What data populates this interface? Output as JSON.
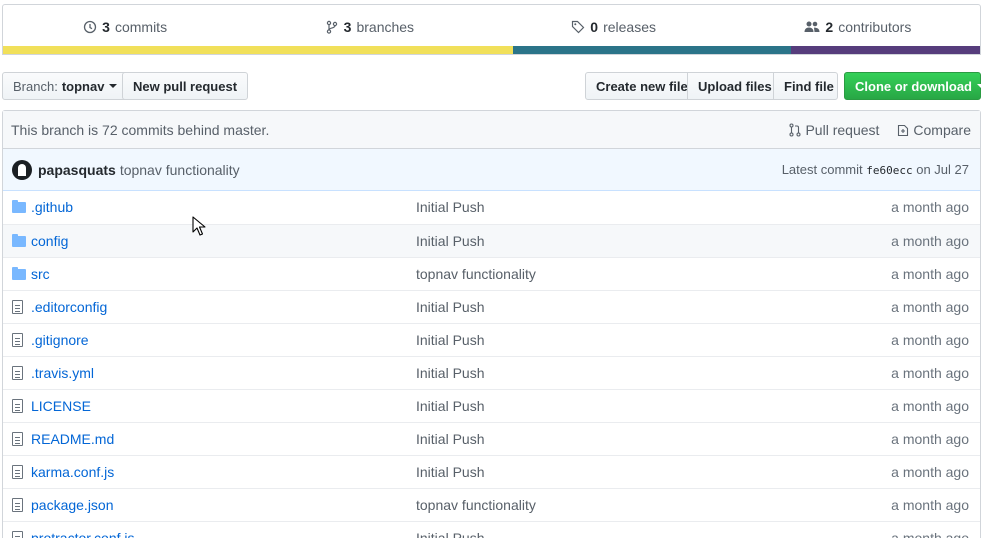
{
  "summary": {
    "commits": {
      "num": "3",
      "label": "commits",
      "icon": "history-icon"
    },
    "branches": {
      "num": "3",
      "label": "branches",
      "icon": "branch-icon"
    },
    "releases": {
      "num": "0",
      "label": "releases",
      "icon": "tag-icon"
    },
    "contributors": {
      "num": "2",
      "label": "contributors",
      "icon": "people-icon"
    }
  },
  "language_bar": [
    {
      "name": "language-1",
      "color": "#f1e05a",
      "fraction": 0.522
    },
    {
      "name": "language-2",
      "color": "#2b7489",
      "fraction": 0.285
    },
    {
      "name": "language-3",
      "color": "#563d7c",
      "fraction": 0.193
    }
  ],
  "toolbar": {
    "branch_prefix": "Branch:",
    "branch_name": "topnav",
    "new_pull_request": "New pull request",
    "create_new_file": "Create new file",
    "upload_files": "Upload files",
    "find_file": "Find file",
    "clone_or_download": "Clone or download"
  },
  "branch_info": {
    "text": "This branch is 72 commits behind master.",
    "pull_request": "Pull request",
    "compare": "Compare"
  },
  "latest_commit": {
    "author": "papasquats",
    "message": "topnav functionality",
    "prefix": "Latest commit",
    "sha": "fe60ecc",
    "date": "on Jul 27"
  },
  "files": [
    {
      "type": "folder",
      "name": ".github",
      "message": "Initial Push",
      "age": "a month ago"
    },
    {
      "type": "folder",
      "name": "config",
      "message": "Initial Push",
      "age": "a month ago"
    },
    {
      "type": "folder",
      "name": "src",
      "message": "topnav functionality",
      "age": "a month ago"
    },
    {
      "type": "file",
      "name": ".editorconfig",
      "message": "Initial Push",
      "age": "a month ago"
    },
    {
      "type": "file",
      "name": ".gitignore",
      "message": "Initial Push",
      "age": "a month ago"
    },
    {
      "type": "file",
      "name": ".travis.yml",
      "message": "Initial Push",
      "age": "a month ago"
    },
    {
      "type": "file",
      "name": "LICENSE",
      "message": "Initial Push",
      "age": "a month ago"
    },
    {
      "type": "file",
      "name": "README.md",
      "message": "Initial Push",
      "age": "a month ago"
    },
    {
      "type": "file",
      "name": "karma.conf.js",
      "message": "Initial Push",
      "age": "a month ago"
    },
    {
      "type": "file",
      "name": "package.json",
      "message": "topnav functionality",
      "age": "a month ago"
    },
    {
      "type": "file",
      "name": "protractor.conf.js",
      "message": "Initial Push",
      "age": "a month ago"
    }
  ]
}
